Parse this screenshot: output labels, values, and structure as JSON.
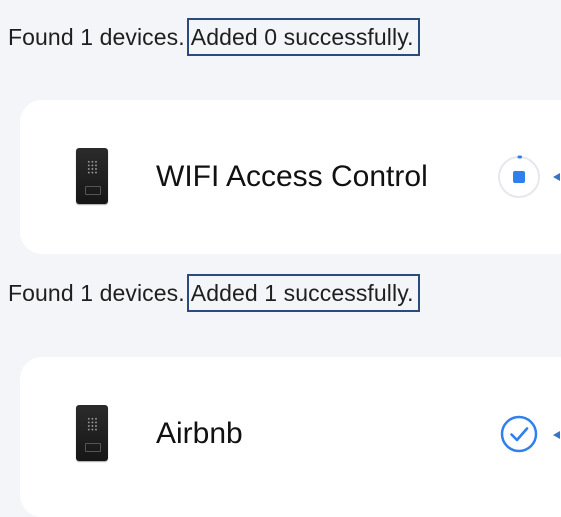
{
  "status_top": {
    "prefix": "Found 1 devices.",
    "highlighted": "Added 0 successfully."
  },
  "status_mid": {
    "prefix": "Found 1 devices.",
    "highlighted": "Added 1 successfully."
  },
  "devices": [
    {
      "name": "WIFI Access Control",
      "state": "in-progress",
      "icon": "access-control-device-icon",
      "state_icon": "stop-progress-icon"
    },
    {
      "name": "Airbnb",
      "state": "added",
      "icon": "access-control-device-icon",
      "state_icon": "check-circle-icon"
    }
  ],
  "colors": {
    "accent": "#2f80ed",
    "highlight_border": "#2a4b7c",
    "card_bg": "#ffffff",
    "page_bg": "#f4f5f9"
  }
}
